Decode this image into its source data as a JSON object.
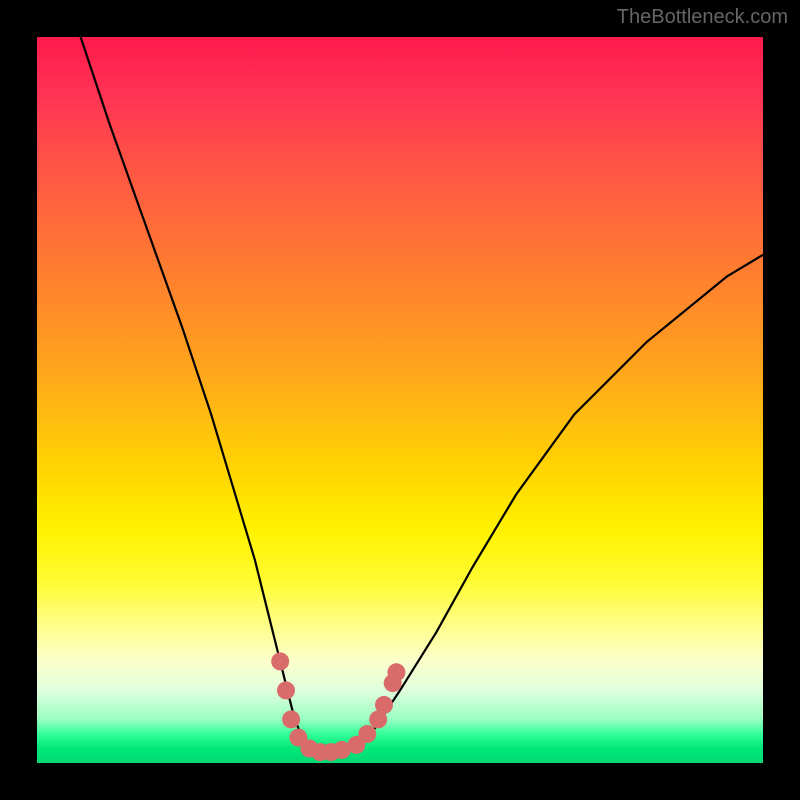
{
  "watermark": "TheBottleneck.com",
  "chart_data": {
    "type": "line",
    "title": "",
    "xlabel": "",
    "ylabel": "",
    "xlim": [
      0,
      100
    ],
    "ylim": [
      0,
      100
    ],
    "series": [
      {
        "name": "bottleneck-curve",
        "x": [
          6,
          10,
          15,
          20,
          24,
          27,
          30,
          32,
          34,
          35.5,
          37,
          39,
          41,
          43,
          46,
          50,
          55,
          60,
          66,
          74,
          84,
          95,
          100
        ],
        "y": [
          100,
          88,
          74,
          60,
          48,
          38,
          28,
          20,
          12,
          6,
          2.5,
          1.5,
          1.5,
          2,
          4,
          10,
          18,
          27,
          37,
          48,
          58,
          67,
          70
        ]
      }
    ],
    "markers": [
      {
        "x": 33.5,
        "y": 14
      },
      {
        "x": 34.3,
        "y": 10
      },
      {
        "x": 35,
        "y": 6
      },
      {
        "x": 36,
        "y": 3.5
      },
      {
        "x": 37.5,
        "y": 2
      },
      {
        "x": 39,
        "y": 1.5
      },
      {
        "x": 40.5,
        "y": 1.5
      },
      {
        "x": 42,
        "y": 1.8
      },
      {
        "x": 44,
        "y": 2.5
      },
      {
        "x": 45.5,
        "y": 4
      },
      {
        "x": 47,
        "y": 6
      },
      {
        "x": 47.8,
        "y": 8
      },
      {
        "x": 49,
        "y": 11
      },
      {
        "x": 49.5,
        "y": 12.5
      }
    ],
    "gradient_stops": [
      {
        "pos": 0,
        "color": "#ff1a4d"
      },
      {
        "pos": 50,
        "color": "#ffc400"
      },
      {
        "pos": 85,
        "color": "#fffec0"
      },
      {
        "pos": 100,
        "color": "#00d973"
      }
    ]
  }
}
